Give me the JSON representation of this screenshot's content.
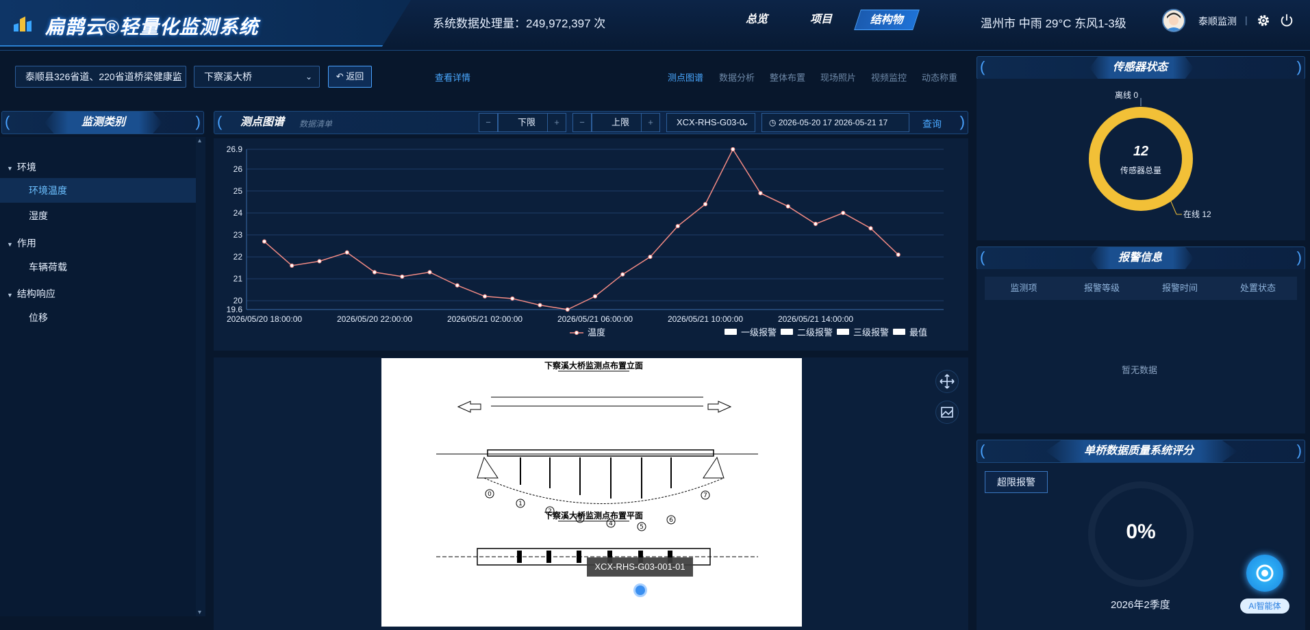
{
  "header": {
    "system_title": "扁鹊云®轻量化监测系统",
    "stat_text": "系统数据处理量：249,972,397 次",
    "nav": [
      "总览",
      "项目",
      "结构物"
    ],
    "nav_active": "结构物",
    "weather": "温州市 中雨 29°C 东风1-3级",
    "user": "泰顺监测",
    "sep": "|"
  },
  "toolbar": {
    "project_select": "泰顺县326省道、220省道桥梁健康监",
    "bridge_select": "下察溪大桥",
    "back_label": "返回",
    "detail_link": "查看详情",
    "tabs": [
      "测点图谱",
      "数据分析",
      "整体布置",
      "现场照片",
      "视频监控",
      "动态称重"
    ],
    "active_tab": "测点图谱"
  },
  "left_panel": {
    "title": "监测类别",
    "groups": [
      {
        "label": "环境",
        "items": [
          "环境温度",
          "湿度"
        ]
      },
      {
        "label": "作用",
        "items": [
          "车辆荷载"
        ]
      },
      {
        "label": "结构响应",
        "items": [
          "位移"
        ]
      }
    ],
    "active_item": "环境温度"
  },
  "chart_panel": {
    "title": "测点图谱",
    "subtitle": "数据清单",
    "minus": "−",
    "plus": "+",
    "lower_label": "下限",
    "upper_label": "上限",
    "sensor_select": "XCX-RHS-G03-0",
    "date_range": "2026-05-20 17   2026-05-21 17",
    "query_label": "查询",
    "legend_series": "温度",
    "legend_alarms": [
      "一级报警",
      "二级报警",
      "三级报警",
      "最值"
    ]
  },
  "chart_data": {
    "type": "line",
    "x": [
      "2026/05/20 18:00:00",
      "2026/05/20 19:00:00",
      "2026/05/20 20:00:00",
      "2026/05/20 21:00:00",
      "2026/05/20 22:00:00",
      "2026/05/20 23:00:00",
      "2026/05/21 00:00:00",
      "2026/05/21 01:00:00",
      "2026/05/21 02:00:00",
      "2026/05/21 03:00:00",
      "2026/05/21 04:00:00",
      "2026/05/21 05:00:00",
      "2026/05/21 06:00:00",
      "2026/05/21 07:00:00",
      "2026/05/21 08:00:00",
      "2026/05/21 09:00:00",
      "2026/05/21 10:00:00",
      "2026/05/21 11:00:00",
      "2026/05/21 12:00:00",
      "2026/05/21 13:00:00",
      "2026/05/21 14:00:00",
      "2026/05/21 15:00:00",
      "2026/05/21 16:00:00",
      "2026/05/21 17:00:00"
    ],
    "x_tick_labels": [
      "2026/05/20 18:00:00",
      "2026/05/20 22:00:00",
      "2026/05/21 02:00:00",
      "2026/05/21 06:00:00",
      "2026/05/21 10:00:00",
      "2026/05/21 14:00:00"
    ],
    "series": [
      {
        "name": "温度",
        "values": [
          22.7,
          21.6,
          21.8,
          22.2,
          21.3,
          21.1,
          21.3,
          20.7,
          20.2,
          20.1,
          19.8,
          19.6,
          20.2,
          21.2,
          22.0,
          23.4,
          24.4,
          26.9,
          24.9,
          24.3,
          23.5,
          24.0,
          23.3,
          22.1
        ]
      }
    ],
    "ylim": [
      19.6,
      26.9
    ],
    "y_ticks": [
      "26.9",
      "26",
      "25",
      "24",
      "23",
      "22",
      "21",
      "20",
      "19.6"
    ],
    "grid": true,
    "legend_position": "bottom"
  },
  "map_panel": {
    "drawing_title_top": "下察溪大桥监测点布置立面",
    "drawing_title_bottom": "下察溪大桥监测点布置平面",
    "tooltip": "XCX-RHS-G03-001-01",
    "pier_numbers": [
      "0",
      "1",
      "2",
      "3",
      "4",
      "5",
      "6",
      "7"
    ]
  },
  "sensor_status": {
    "title": "传感器状态",
    "offline": "离线 0",
    "online": "在线 12",
    "total": "12",
    "total_label": "传感器总量",
    "ring_color": "#f2c037"
  },
  "alarm_info": {
    "title": "报警信息",
    "columns": [
      "监测项",
      "报警等级",
      "报警时间",
      "处置状态"
    ],
    "empty": "暂无数据"
  },
  "quality": {
    "title": "单桥数据质量系统评分",
    "button": "超限报警",
    "percent": "0%",
    "period": "2026年2季度"
  },
  "ai": {
    "label": "AI智能体"
  }
}
